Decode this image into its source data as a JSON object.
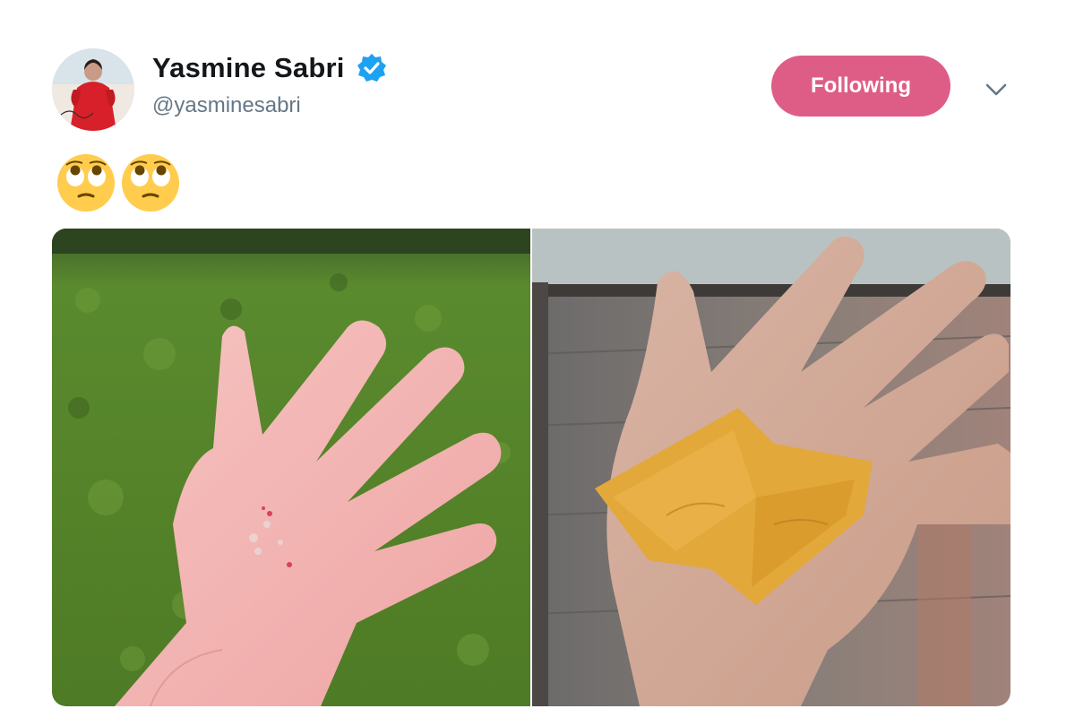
{
  "tweet": {
    "author": {
      "display_name": "Yasmine Sabri",
      "handle": "@yasminesabri",
      "verified": true,
      "avatar_icon": "avatar-red-dress"
    },
    "follow_button": {
      "label": "Following"
    },
    "menu_icon": "chevron-down-icon",
    "text_emoji": [
      "🙄",
      "🙄"
    ],
    "media": [
      {
        "icon": "photo-hand-with-blisters"
      },
      {
        "icon": "photo-hand-with-bandage"
      }
    ]
  },
  "colors": {
    "follow_button_bg": "#de5d87",
    "name": "#14171a",
    "handle": "#657786",
    "verified": "#1da1f2"
  }
}
